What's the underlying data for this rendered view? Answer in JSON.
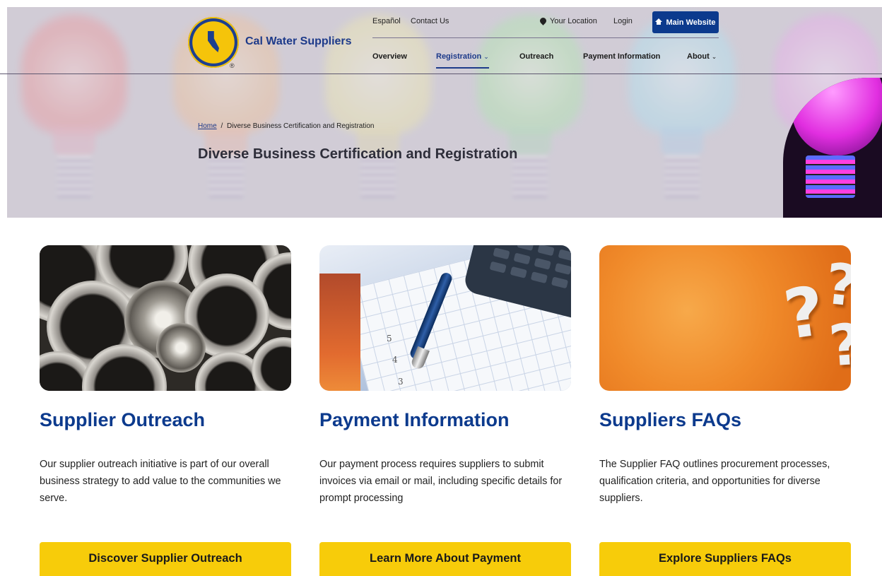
{
  "header": {
    "brand_name": "Cal Water Suppliers",
    "logo_mark": "®",
    "utility": {
      "espanol": "Español",
      "contact": "Contact Us",
      "location": "Your Location",
      "login": "Login",
      "main_website": "Main Website"
    },
    "nav": [
      {
        "label": "Overview"
      },
      {
        "label": "Registration",
        "active": true,
        "chevron": "⌄"
      },
      {
        "label": "Outreach"
      },
      {
        "label": "Payment Information"
      },
      {
        "label": "About",
        "chevron": "⌄"
      }
    ],
    "icons": {
      "location": "location-pin-icon",
      "home": "home-icon"
    },
    "accent_color": "#0c3a8d"
  },
  "hero": {
    "breadcrumb": {
      "home": "Home",
      "separator": "/",
      "current": "Diverse Business Certification and Registration"
    },
    "title": "Diverse Business Certification and Registration"
  },
  "cards": [
    {
      "title": "Supplier Outreach",
      "body": "Our supplier outreach initiative is part of our overall business strategy to add value to the communities we serve.",
      "button": "Discover Supplier Outreach"
    },
    {
      "title": "Payment Information",
      "body": "Our payment process requires suppliers to submit invoices via email or mail, including specific details for prompt processing",
      "button": "Learn More About Payment"
    },
    {
      "title": "Suppliers FAQs",
      "body": "The Supplier FAQ outlines procurement processes, qualification criteria, and opportunities for diverse suppliers.",
      "button": "Explore Suppliers FAQs"
    }
  ],
  "colors": {
    "button_yellow": "#f7cc0a",
    "heading_blue": "#0c3a8d"
  }
}
